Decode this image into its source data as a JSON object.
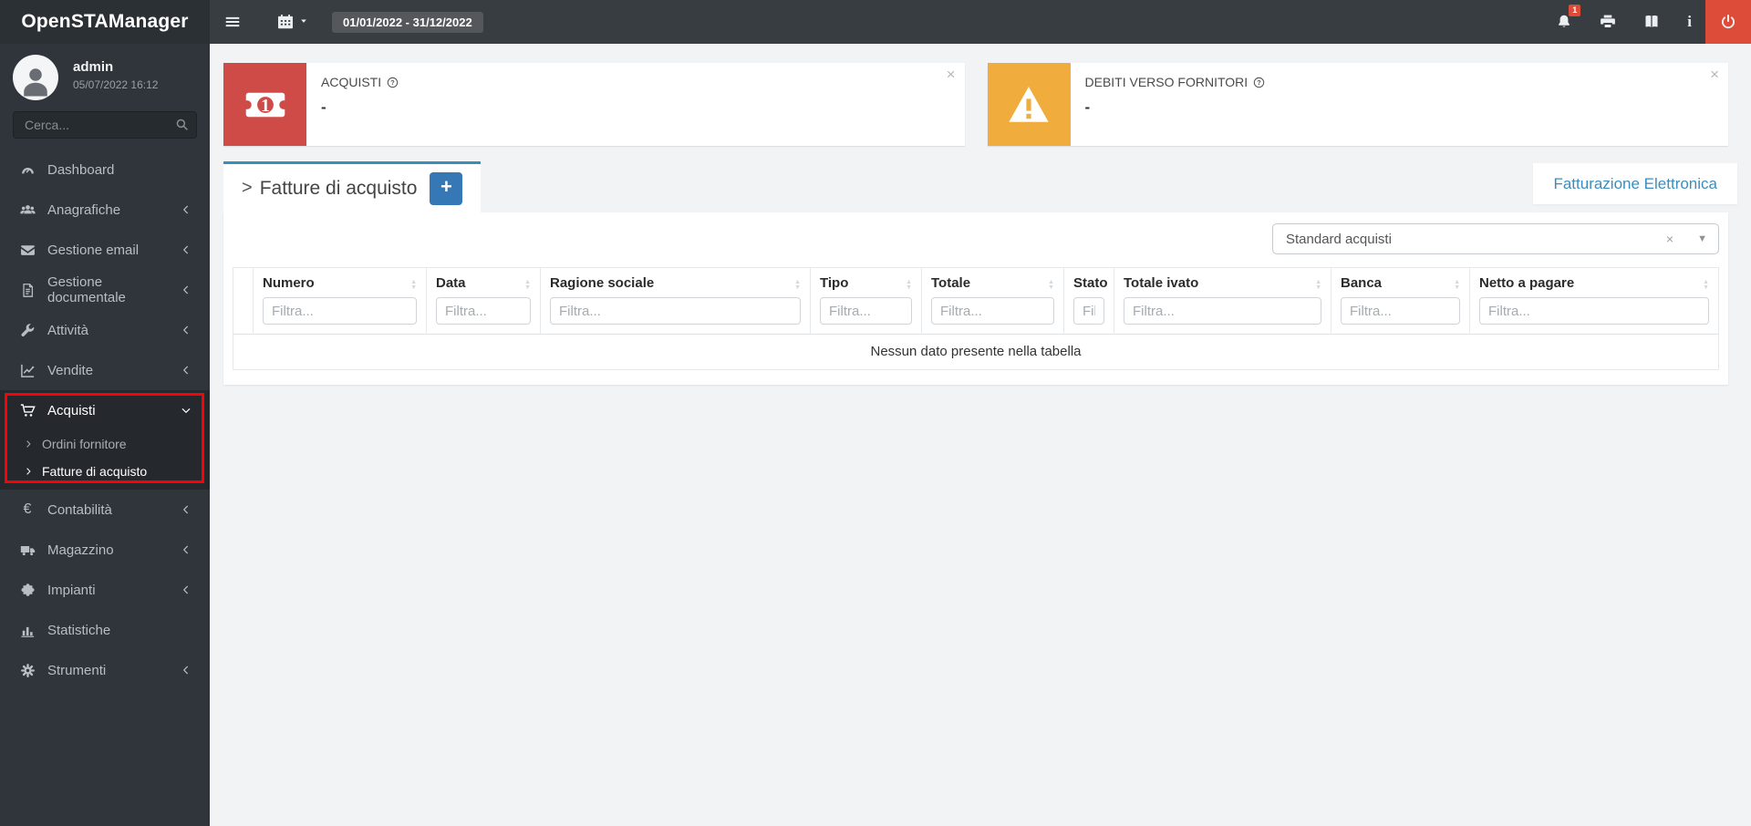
{
  "app": {
    "title": "OpenSTAManager"
  },
  "topbar": {
    "date_range": "01/01/2022 - 31/12/2022",
    "actions": [
      {
        "name": "bell-icon",
        "badge": "1"
      },
      {
        "name": "printer-icon"
      },
      {
        "name": "book-icon"
      },
      {
        "name": "info-icon"
      },
      {
        "name": "power-icon"
      }
    ]
  },
  "sidebar": {
    "user": {
      "name": "admin",
      "datetime": "05/07/2022 16:12"
    },
    "search": {
      "placeholder": "Cerca..."
    },
    "items": [
      {
        "id": "dashboard",
        "label": "Dashboard",
        "icon": "gauge-icon",
        "chevron": null
      },
      {
        "id": "anagrafiche",
        "label": "Anagrafiche",
        "icon": "users-icon",
        "chevron": "left"
      },
      {
        "id": "gestione-email",
        "label": "Gestione email",
        "icon": "envelope-icon",
        "chevron": "left"
      },
      {
        "id": "gestione-documentale",
        "label": "Gestione documentale",
        "icon": "document-icon",
        "chevron": "left"
      },
      {
        "id": "attivita",
        "label": "Attività",
        "icon": "wrench-icon",
        "chevron": "left"
      },
      {
        "id": "vendite",
        "label": "Vendite",
        "icon": "chart-line-icon",
        "chevron": "left"
      },
      {
        "id": "acquisti",
        "label": "Acquisti",
        "icon": "cart-icon",
        "chevron": "down",
        "active": true,
        "highlighted": true,
        "children": [
          {
            "id": "ordini-fornitore",
            "label": "Ordini fornitore",
            "active": false
          },
          {
            "id": "fatture-di-acquisto",
            "label": "Fatture di acquisto",
            "active": true
          }
        ]
      },
      {
        "id": "contabilita",
        "label": "Contabilità",
        "icon": "euro-icon",
        "chevron": "left"
      },
      {
        "id": "magazzino",
        "label": "Magazzino",
        "icon": "truck-icon",
        "chevron": "left"
      },
      {
        "id": "impianti",
        "label": "Impianti",
        "icon": "puzzle-icon",
        "chevron": "left"
      },
      {
        "id": "statistiche",
        "label": "Statistiche",
        "icon": "bar-chart-icon",
        "chevron": null
      },
      {
        "id": "strumenti",
        "label": "Strumenti",
        "icon": "gear-icon",
        "chevron": "left"
      }
    ]
  },
  "cards": [
    {
      "label": "ACQUISTI",
      "value": "-",
      "icon": "money-bill-icon",
      "color": "#ce4b48",
      "close_label": "×"
    },
    {
      "label": "DEBITI VERSO FORNITORI",
      "value": "-",
      "icon": "warning-icon",
      "color": "#f0ad3e",
      "close_label": "×"
    }
  ],
  "tabs": {
    "active_title": "Fatture di acquisto",
    "caret": ">",
    "add_button_label": "+",
    "right_link": "Fatturazione Elettronica"
  },
  "filter_select": {
    "value": "Standard acquisti",
    "clear_label": "×",
    "caret": "▼"
  },
  "table": {
    "columns": [
      {
        "label": "",
        "filter_placeholder": "",
        "sortable": false
      },
      {
        "label": "Numero",
        "filter_placeholder": "Filtra...",
        "sortable": true
      },
      {
        "label": "Data",
        "filter_placeholder": "Filtra...",
        "sortable": true
      },
      {
        "label": "Ragione sociale",
        "filter_placeholder": "Filtra...",
        "sortable": true
      },
      {
        "label": "Tipo",
        "filter_placeholder": "Filtra...",
        "sortable": true
      },
      {
        "label": "Totale",
        "filter_placeholder": "Filtra...",
        "sortable": true
      },
      {
        "label": "Stato",
        "filter_placeholder": "Filtra...",
        "sortable": false
      },
      {
        "label": "Totale ivato",
        "filter_placeholder": "Filtra...",
        "sortable": true
      },
      {
        "label": "Banca",
        "filter_placeholder": "Filtra...",
        "sortable": true
      },
      {
        "label": "Netto a pagare",
        "filter_placeholder": "Filtra...",
        "sortable": true
      }
    ],
    "rows": [],
    "empty_message": "Nessun dato presente nella tabella"
  },
  "colors": {
    "accent_blue": "#3c8dbc",
    "button_blue": "#3578b5",
    "danger_red": "#dd4b39",
    "card_red": "#ce4b48",
    "card_orange": "#f0ad3e",
    "annotation_red": "#fb0007",
    "sidebar_bg": "#2f353a",
    "topbar_bg": "#383d42"
  }
}
